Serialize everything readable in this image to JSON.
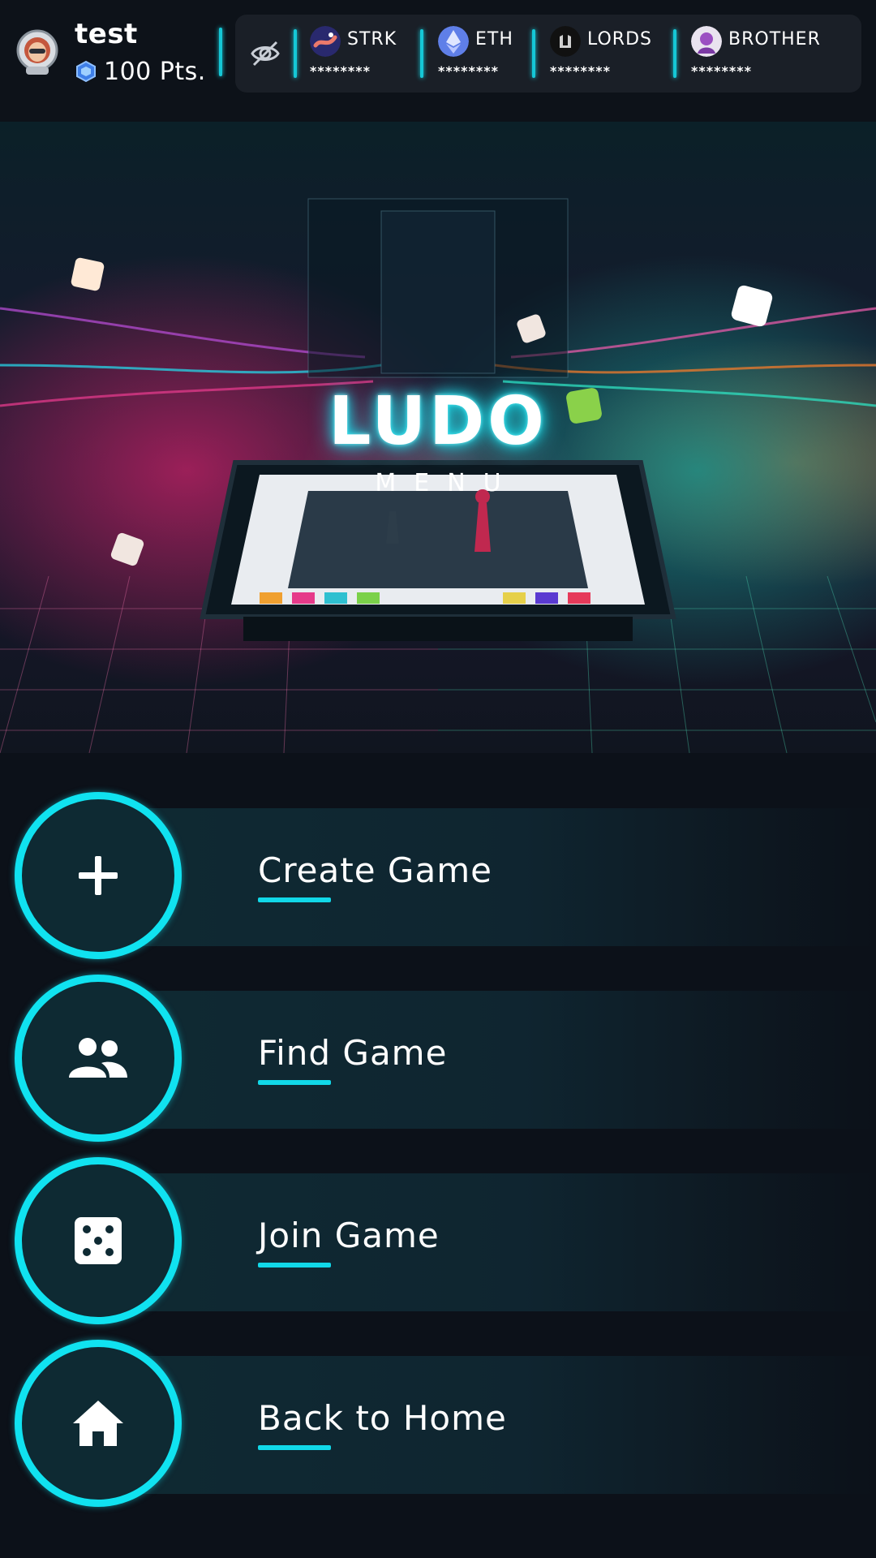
{
  "user": {
    "name": "test",
    "points": "100 Pts.",
    "avatar_icon": "astronaut-avatar-icon",
    "points_icon": "gem-icon"
  },
  "balance_visibility": {
    "icon": "eye-off-icon"
  },
  "tokens": [
    {
      "symbol": "STRK",
      "value": "********",
      "icon": "starknet-logo-icon"
    },
    {
      "symbol": "ETH",
      "value": "********",
      "icon": "ethereum-logo-icon"
    },
    {
      "symbol": "LORDS",
      "value": "********",
      "icon": "lords-logo-icon"
    },
    {
      "symbol": "BROTHER",
      "value": "********",
      "icon": "brother-logo-icon"
    }
  ],
  "hero": {
    "title": "LUDO",
    "subtitle": "MENU"
  },
  "menu": [
    {
      "label": "Create Game",
      "icon": "plus-icon"
    },
    {
      "label": "Find Game",
      "icon": "users-icon"
    },
    {
      "label": "Join Game",
      "icon": "dice-icon"
    },
    {
      "label": "Back to Home",
      "icon": "home-icon"
    }
  ],
  "colors": {
    "background": "#0c1119",
    "accent": "#10e2f0",
    "panel": "#1a1f27",
    "menu_bar": "#0f2a33"
  }
}
